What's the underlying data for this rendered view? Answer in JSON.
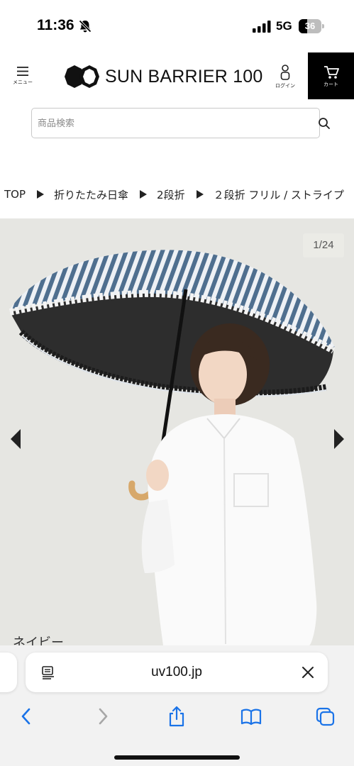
{
  "status_bar": {
    "time": "11:36",
    "network": "5G",
    "battery_level": "36",
    "battery_fraction": 0.36,
    "icons": [
      "bell-slash-icon",
      "signal-bars-icon",
      "battery-icon"
    ]
  },
  "header": {
    "menu_label": "メニュー",
    "logo_text": "SUN BARRIER 100",
    "login_label": "ログイン",
    "cart_label": "カート",
    "icons": [
      "hamburger-icon",
      "logo-mark-icon",
      "person-icon",
      "cart-icon"
    ]
  },
  "search": {
    "placeholder": "商品検索",
    "value": "",
    "icon": "search-icon"
  },
  "breadcrumb": {
    "items": [
      "TOP",
      "折りたたみ日傘",
      "2段折",
      "２段折 フリル / ストライプ"
    ],
    "separator_icon": "triangle-right-icon"
  },
  "gallery": {
    "counter": "1/24",
    "color_caption": "ネイビー",
    "prev_icon": "triangle-left-icon",
    "next_icon": "triangle-right-icon",
    "colors": {
      "background": "#e6e6e2",
      "stripe_dark": "#4f6f8f",
      "stripe_light": "#eef1f5"
    }
  },
  "browser": {
    "address": "uv100.jp",
    "icons": [
      "reader-mode-icon",
      "clear-icon",
      "back-icon",
      "forward-icon",
      "share-icon",
      "bookmarks-icon",
      "tabs-icon"
    ],
    "accent_color": "#1a73e8"
  }
}
